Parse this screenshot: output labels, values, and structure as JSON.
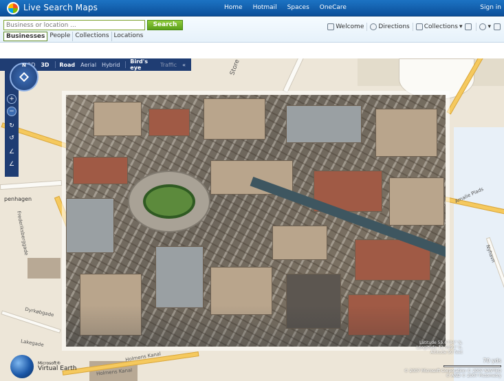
{
  "header": {
    "app_title": "Live Search Maps",
    "nav": [
      "Home",
      "Hotmail",
      "Spaces",
      "OneCare"
    ],
    "signin": "Sign in"
  },
  "search": {
    "placeholder": "Business or location ...",
    "button_label": "Search",
    "categories": [
      "Businesses",
      "People",
      "Collections",
      "Locations"
    ],
    "active_category": "Businesses"
  },
  "tools": {
    "welcome": "Welcome",
    "directions": "Directions",
    "collections": "Collections"
  },
  "map": {
    "view_modes": [
      "2D",
      "3D",
      "Road",
      "Aerial",
      "Hybrid",
      "Bird's eye",
      "Traffic"
    ],
    "active_modes": [
      "3D",
      "Road",
      "Bird's eye"
    ],
    "collapse_label": "«",
    "compass_label": "N",
    "street_labels": [
      "Store",
      "penhagen",
      "Frederiksberggade",
      "Holmens Kanal",
      "Dyrkøbgade",
      "Lakegade",
      "Amalie Plads",
      "Holmens Kanal",
      "Nyhavn"
    ],
    "attribution": {
      "coordinates": "Latitude 55.6784° N, Longitude 12.5891° E, Altitude 90 feet",
      "scale": "70 yds",
      "copyright_1": "© 2007 Microsoft Corporation  © 2007 NAVTEQ",
      "copyright_2": "© AND  © 2007 Pictometry"
    },
    "logo": {
      "microsoft": "Microsoft®",
      "product": "Virtual Earth"
    }
  }
}
